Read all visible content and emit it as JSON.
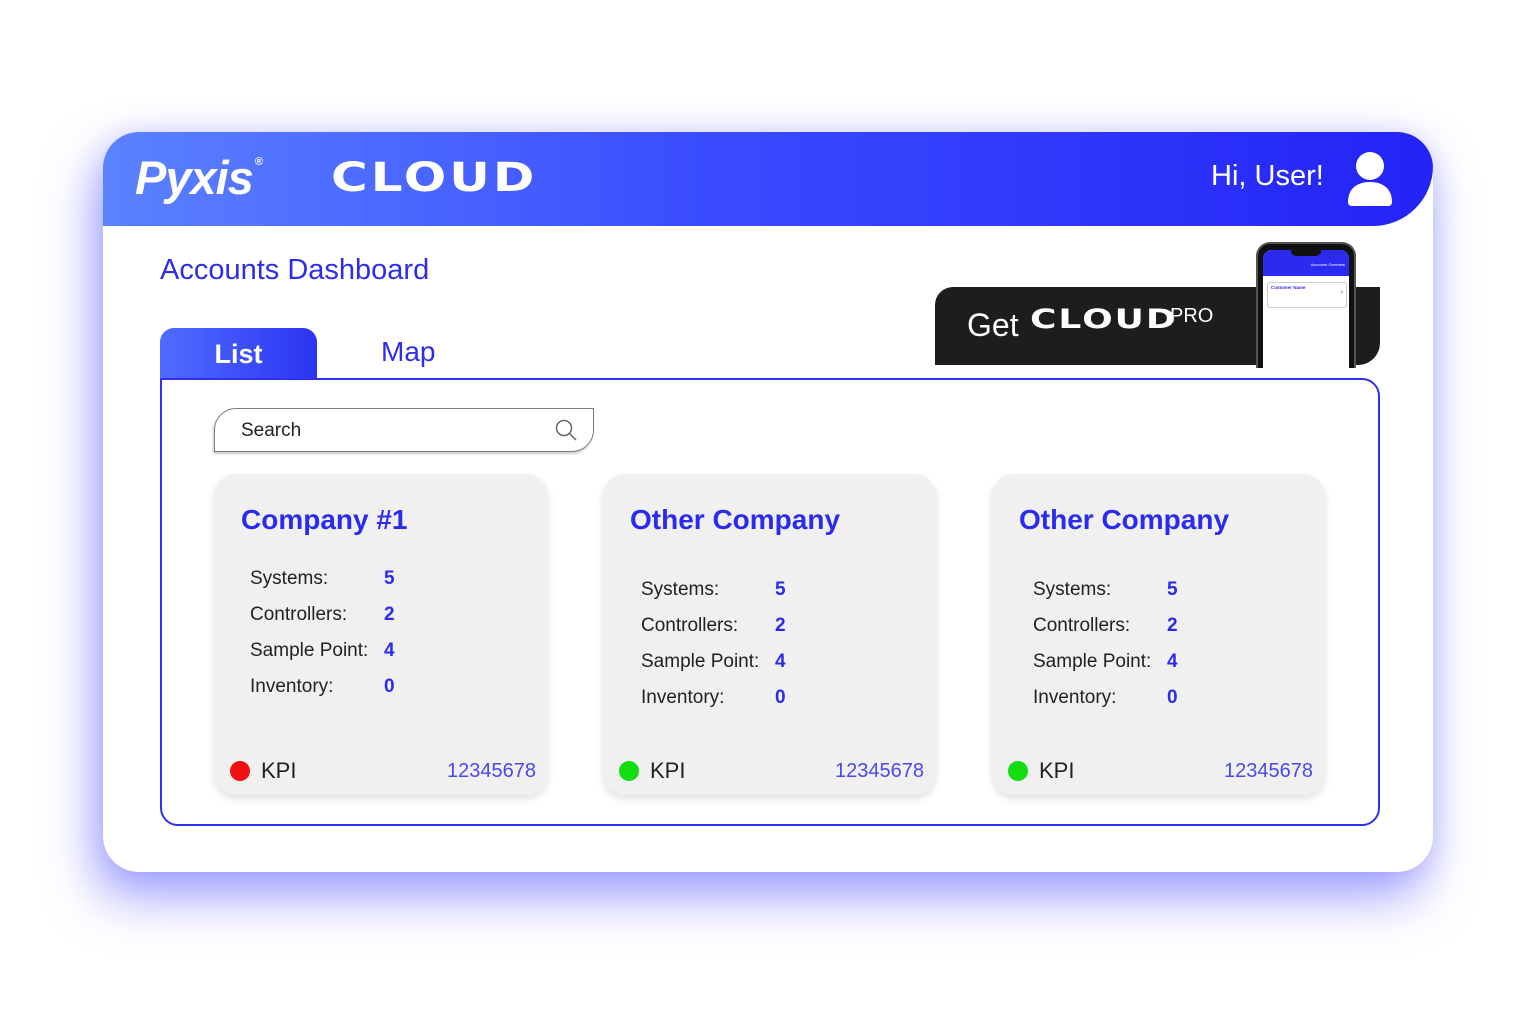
{
  "header": {
    "brand": "Pyxis",
    "brand_mark": "®",
    "product": "CLOUD",
    "greeting": "Hi, User!",
    "avatar_icon": "user-icon"
  },
  "page": {
    "title": "Accounts Dashboard"
  },
  "tabs": [
    {
      "label": "List",
      "active": true
    },
    {
      "label": "Map",
      "active": false
    }
  ],
  "promo": {
    "get": "Get",
    "product": "CLOUD",
    "tier": "PRO",
    "phone": {
      "bar_text": "Accounts Overview",
      "card_title": "Customer Name"
    }
  },
  "search": {
    "placeholder": "Search",
    "value": "",
    "icon": "search-icon"
  },
  "stat_labels": [
    "Systems:",
    "Controllers:",
    "Sample Point:",
    "Inventory:"
  ],
  "cards": [
    {
      "title": "Company #1",
      "stats": [
        "5",
        "2",
        "4",
        "0"
      ],
      "kpi_label": "KPI",
      "kpi_status": "red",
      "kpi_color": "#ee1111",
      "number": "12345678"
    },
    {
      "title": "Other Company",
      "stats": [
        "5",
        "2",
        "4",
        "0"
      ],
      "kpi_label": "KPI",
      "kpi_status": "green",
      "kpi_color": "#11dd11",
      "number": "12345678"
    },
    {
      "title": "Other Company",
      "stats": [
        "5",
        "2",
        "4",
        "0"
      ],
      "kpi_label": "KPI",
      "kpi_status": "green",
      "kpi_color": "#11dd11",
      "number": "12345678"
    }
  ],
  "colors": {
    "accent": "#2b2bf0",
    "header_start": "#5b82ff",
    "header_end": "#2323f5",
    "promo_bg": "#1d1d1d"
  }
}
